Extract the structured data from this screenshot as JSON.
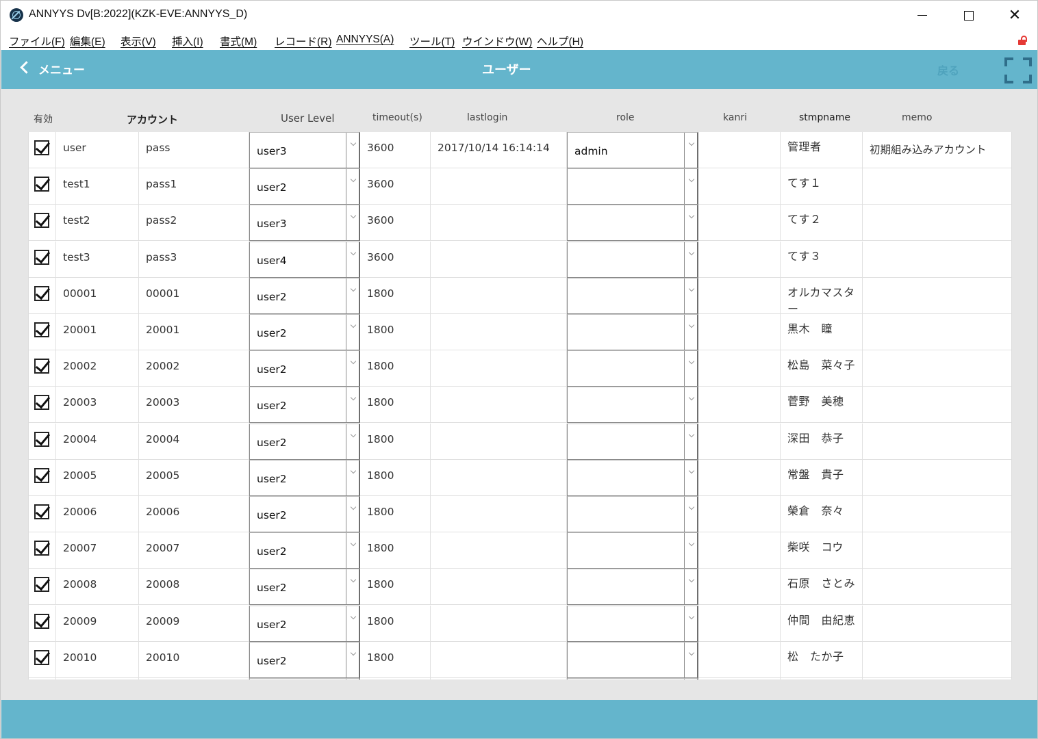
{
  "window": {
    "title": "ANNYYS Dv[B:2022](KZK-EVE:ANNYYS_D)",
    "close_glyph": "✕"
  },
  "menu": [
    {
      "label": "ファイル(F)"
    },
    {
      "label": "編集(E)"
    },
    {
      "label": "表示(V)"
    },
    {
      "label": "挿入(I)"
    },
    {
      "label": "書式(M)"
    },
    {
      "label": "レコード(R)"
    },
    {
      "label": "ANNYYS(A)"
    },
    {
      "label": "ツール(T)"
    },
    {
      "label": "ウインドウ(W)"
    },
    {
      "label": "ヘルプ(H)"
    }
  ],
  "header": {
    "back_label": "メニュー",
    "title": "ユーザー",
    "return_label": "戻る"
  },
  "columns": {
    "enabled": "有効",
    "account": "アカウント",
    "user_level": "User Level",
    "timeout": "timeout(s)",
    "lastlogin": "lastlogin",
    "role": "role",
    "kanri": "kanri",
    "stmpname": "stmpname",
    "memo": "memo"
  },
  "rows": [
    {
      "enabled": true,
      "account": "user",
      "password": "pass",
      "user_level": "user3",
      "timeout": "3600",
      "lastlogin": "2017/10/14 16:14:14",
      "role": "admin",
      "kanri": "",
      "stmpname": "管理者",
      "memo": "初期組み込みアカウント"
    },
    {
      "enabled": true,
      "account": "test1",
      "password": "pass1",
      "user_level": "user2",
      "timeout": "3600",
      "lastlogin": "",
      "role": "",
      "kanri": "",
      "stmpname": "てす１",
      "memo": ""
    },
    {
      "enabled": true,
      "account": "test2",
      "password": "pass2",
      "user_level": "user3",
      "timeout": "3600",
      "lastlogin": "",
      "role": "",
      "kanri": "",
      "stmpname": "てす２",
      "memo": ""
    },
    {
      "enabled": true,
      "account": "test3",
      "password": "pass3",
      "user_level": "user4",
      "timeout": "3600",
      "lastlogin": "",
      "role": "",
      "kanri": "",
      "stmpname": "てす３",
      "memo": ""
    },
    {
      "enabled": true,
      "account": "00001",
      "password": "00001",
      "user_level": "user2",
      "timeout": "1800",
      "lastlogin": "",
      "role": "",
      "kanri": "",
      "stmpname": "オルカマスター",
      "memo": ""
    },
    {
      "enabled": true,
      "account": "20001",
      "password": "20001",
      "user_level": "user2",
      "timeout": "1800",
      "lastlogin": "",
      "role": "",
      "kanri": "",
      "stmpname": "黒木　瞳",
      "memo": ""
    },
    {
      "enabled": true,
      "account": "20002",
      "password": "20002",
      "user_level": "user2",
      "timeout": "1800",
      "lastlogin": "",
      "role": "",
      "kanri": "",
      "stmpname": "松島　菜々子",
      "memo": ""
    },
    {
      "enabled": true,
      "account": "20003",
      "password": "20003",
      "user_level": "user2",
      "timeout": "1800",
      "lastlogin": "",
      "role": "",
      "kanri": "",
      "stmpname": "菅野　美穂",
      "memo": ""
    },
    {
      "enabled": true,
      "account": "20004",
      "password": "20004",
      "user_level": "user2",
      "timeout": "1800",
      "lastlogin": "",
      "role": "",
      "kanri": "",
      "stmpname": "深田　恭子",
      "memo": ""
    },
    {
      "enabled": true,
      "account": "20005",
      "password": "20005",
      "user_level": "user2",
      "timeout": "1800",
      "lastlogin": "",
      "role": "",
      "kanri": "",
      "stmpname": "常盤　貴子",
      "memo": ""
    },
    {
      "enabled": true,
      "account": "20006",
      "password": "20006",
      "user_level": "user2",
      "timeout": "1800",
      "lastlogin": "",
      "role": "",
      "kanri": "",
      "stmpname": "榮倉　奈々",
      "memo": ""
    },
    {
      "enabled": true,
      "account": "20007",
      "password": "20007",
      "user_level": "user2",
      "timeout": "1800",
      "lastlogin": "",
      "role": "",
      "kanri": "",
      "stmpname": "柴咲　コウ",
      "memo": ""
    },
    {
      "enabled": true,
      "account": "20008",
      "password": "20008",
      "user_level": "user2",
      "timeout": "1800",
      "lastlogin": "",
      "role": "",
      "kanri": "",
      "stmpname": "石原　さとみ",
      "memo": ""
    },
    {
      "enabled": true,
      "account": "20009",
      "password": "20009",
      "user_level": "user2",
      "timeout": "1800",
      "lastlogin": "",
      "role": "",
      "kanri": "",
      "stmpname": "仲間　由紀恵",
      "memo": ""
    },
    {
      "enabled": true,
      "account": "20010",
      "password": "20010",
      "user_level": "user2",
      "timeout": "1800",
      "lastlogin": "",
      "role": "",
      "kanri": "",
      "stmpname": "松　たか子",
      "memo": ""
    }
  ],
  "colors": {
    "header_bg": "#64b5cc",
    "return_btn": "#4fa3bd",
    "fullscreen_icon": "#2f6e8a",
    "lock_icon": "#e53935"
  },
  "icons": {
    "app": "app-logo-icon",
    "back": "chevron-left-icon",
    "fullscreen": "fullscreen-icon",
    "lock": "unlocked-icon",
    "dropdown": "chevron-down-icon",
    "checkbox": "checkbox-checked-icon"
  }
}
